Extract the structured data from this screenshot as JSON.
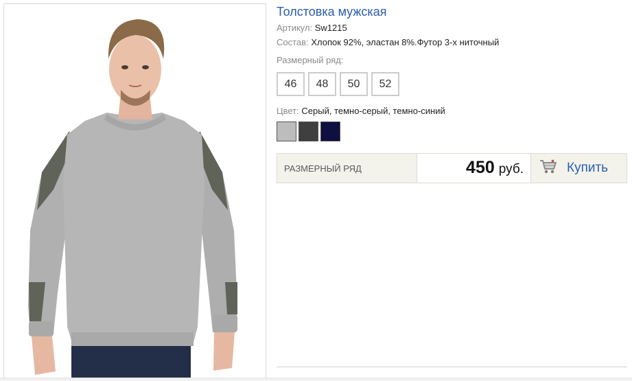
{
  "product": {
    "title": "Толстовка мужская",
    "article_label": "Артикул:",
    "article_value": "Sw1215",
    "composition_label": "Состав:",
    "composition_value": "Хлопок 92%, эластан 8%.Футор 3-х ниточный",
    "sizes_label": "Размерный ряд:",
    "sizes": [
      "46",
      "48",
      "50",
      "52"
    ],
    "color_label": "Цвет:",
    "color_value": "Серый, темно-серый, темно-синий",
    "swatches": [
      {
        "name": "серый",
        "hex": "#bdbdbd"
      },
      {
        "name": "темно-серый",
        "hex": "#3f3f3f"
      },
      {
        "name": "темно-синий",
        "hex": "#0e1040"
      }
    ]
  },
  "purchase_bar": {
    "size_range_label": "РАЗМЕРНЫЙ РЯД",
    "price": "450",
    "currency": "руб.",
    "buy_label": "Купить",
    "buy_icon": "cart-icon"
  },
  "colors": {
    "link": "#2a5db0",
    "bar_bg": "#f3f3ec",
    "sweater": "#b4b4b4",
    "patch": "#5f6358"
  }
}
